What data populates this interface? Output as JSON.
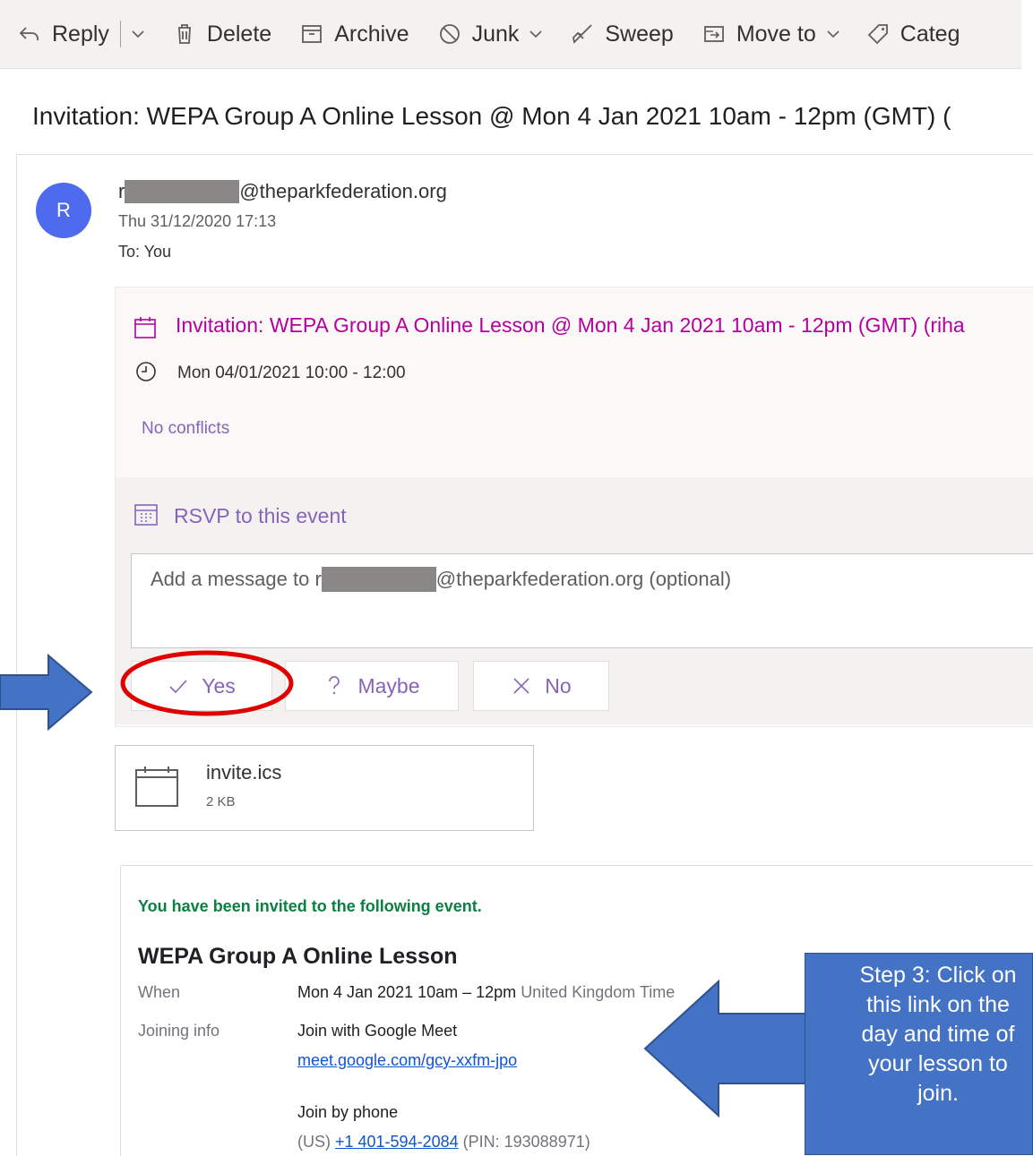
{
  "toolbar": {
    "reply": "Reply",
    "delete": "Delete",
    "archive": "Archive",
    "junk": "Junk",
    "sweep": "Sweep",
    "move_to": "Move to",
    "categorize": "Categ"
  },
  "subject": "Invitation: WEPA Group A Online Lesson @ Mon 4 Jan 2021 10am - 12pm (GMT) (",
  "sender": {
    "avatar_initial": "R",
    "email_prefix": "r",
    "email_suffix": "@theparkfederation.org",
    "date": "Thu 31/12/2020 17:13",
    "to": "To: You"
  },
  "invite": {
    "title": "Invitation: WEPA Group A Online Lesson @ Mon 4 Jan 2021 10am - 12pm (GMT) (riha",
    "time": "Mon 04/01/2021 10:00 - 12:00",
    "conflicts": "No conflicts",
    "rsvp_title": "RSVP to this event",
    "message_prefix": "Add a message to r",
    "message_suffix": "@theparkfederation.org (optional)",
    "yes": "Yes",
    "maybe": "Maybe",
    "no": "No"
  },
  "attachment": {
    "name": "invite.ics",
    "size": "2 KB"
  },
  "event": {
    "invited_text": "You have been invited to the following event.",
    "title": "WEPA Group A Online Lesson",
    "when_label": "When",
    "when_value": "Mon 4 Jan 2021 10am – 12pm",
    "when_tz": "United Kingdom Time",
    "joining_label": "Joining info",
    "join_meet": "Join with Google Meet",
    "meet_link": "meet.google.com/gcy-xxfm-jpo",
    "join_phone": "Join by phone",
    "phone_prefix": "(US) ",
    "phone_number": "+1 401-594-2084",
    "phone_pin": " (PIN: 193088971)"
  },
  "callout": {
    "line1": "Step 3: Click on",
    "line2": "this link on the",
    "line3": "day and time of",
    "line4": "your lesson to",
    "line5": "join."
  },
  "colors": {
    "accent_purple": "#8764b8",
    "magenta": "#b4009e",
    "arrow_blue": "#4472c4",
    "highlight_red": "#e00000",
    "invite_green": "#0b8043"
  }
}
